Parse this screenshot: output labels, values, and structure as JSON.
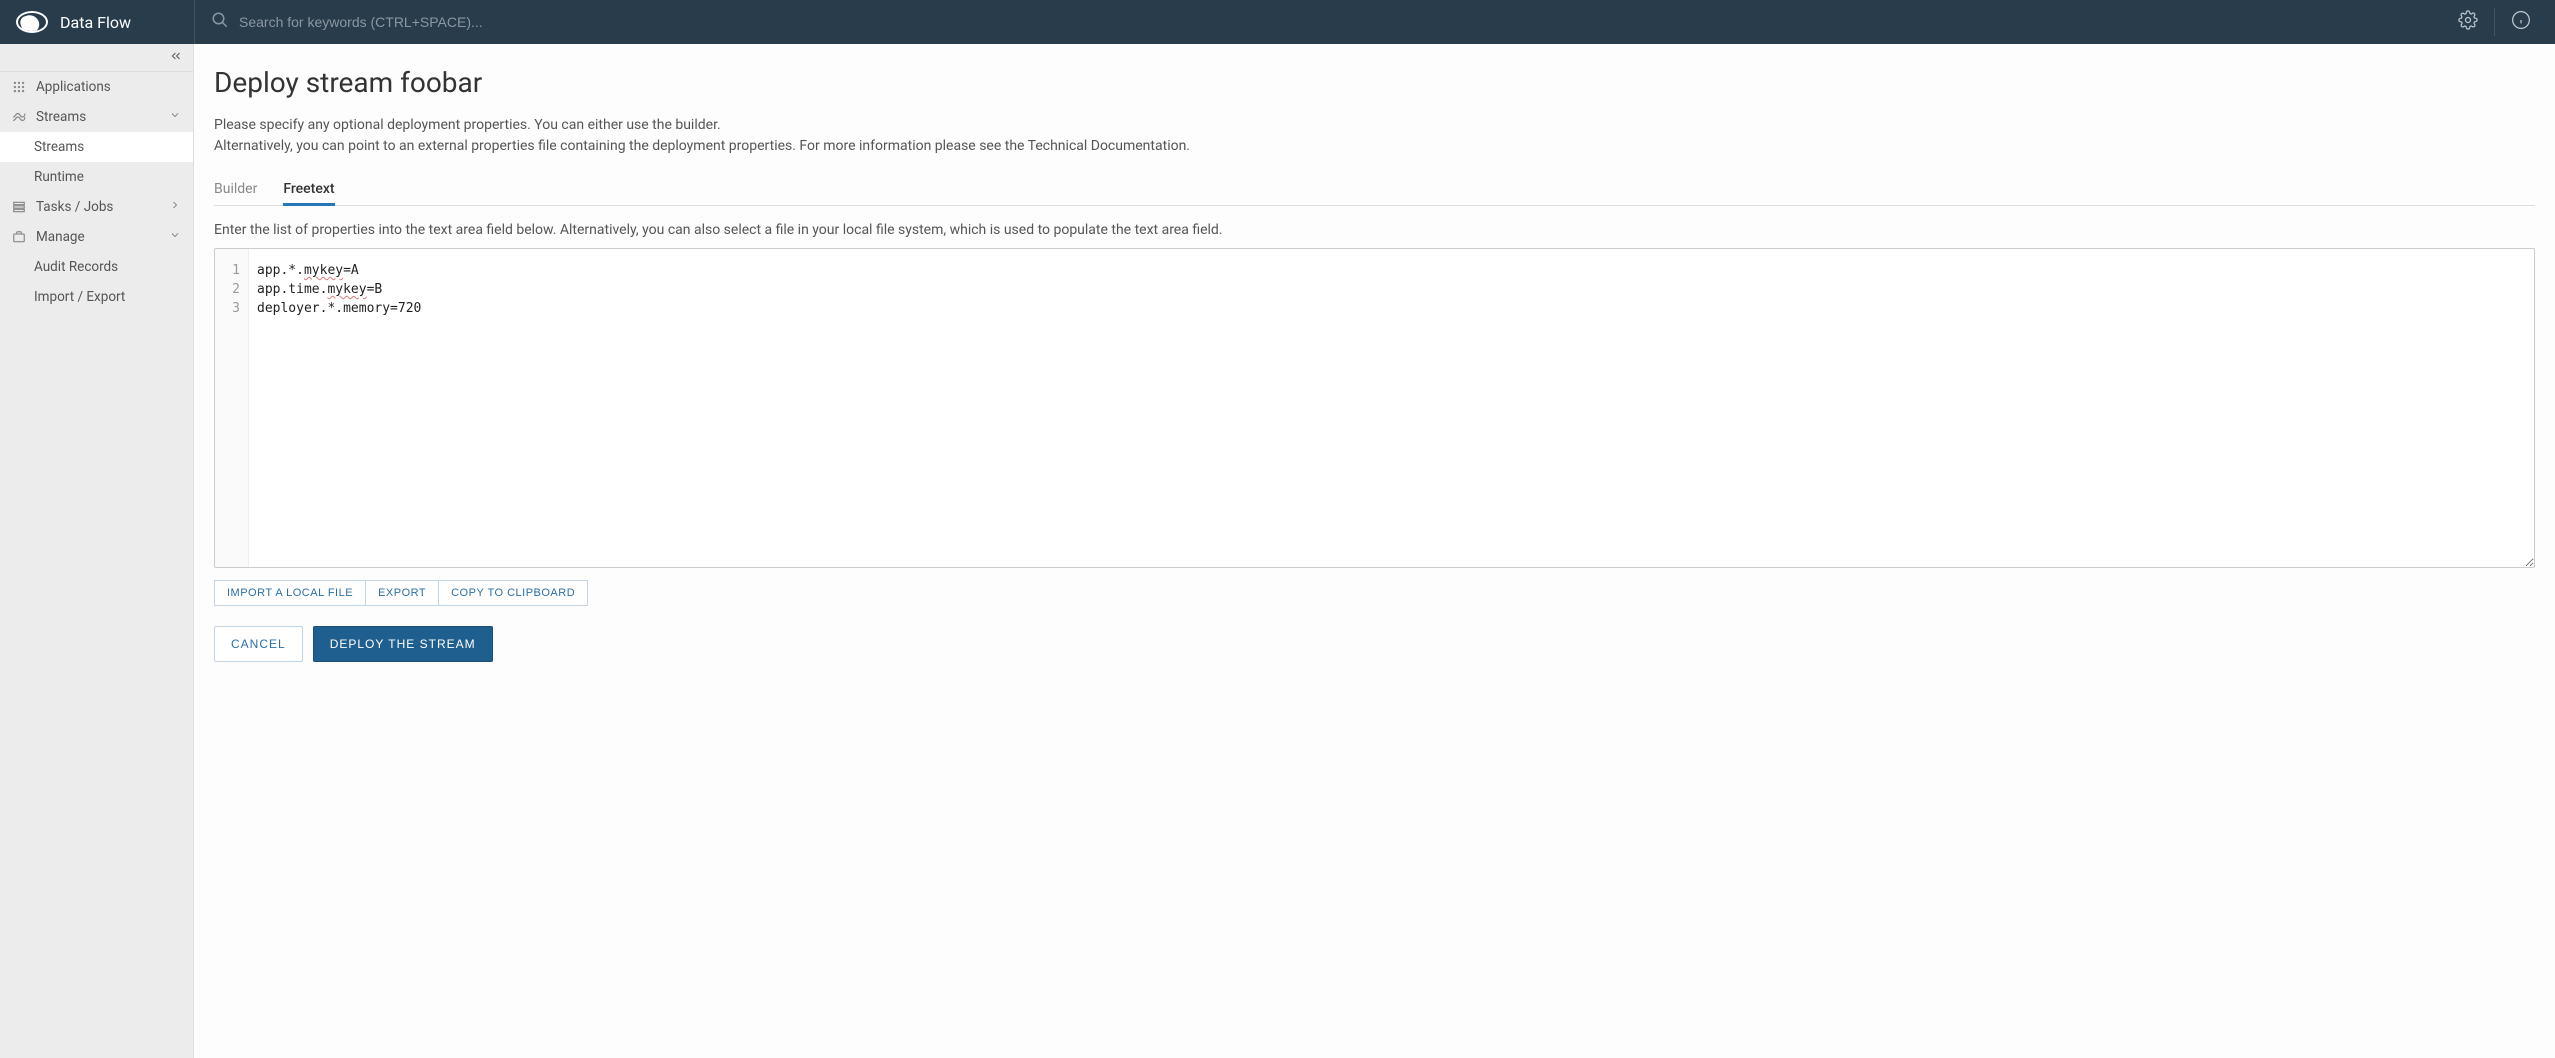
{
  "header": {
    "app_name": "Data Flow",
    "search_placeholder": "Search for keywords (CTRL+SPACE)..."
  },
  "sidebar": {
    "items": [
      {
        "label": "Applications",
        "icon": "grid-icon",
        "expandable": false
      },
      {
        "label": "Streams",
        "icon": "streams-icon",
        "expandable": true,
        "expanded": true,
        "children": [
          {
            "label": "Streams",
            "active": true
          },
          {
            "label": "Runtime",
            "active": false
          }
        ]
      },
      {
        "label": "Tasks / Jobs",
        "icon": "tasks-icon",
        "expandable": true,
        "expanded": false
      },
      {
        "label": "Manage",
        "icon": "manage-icon",
        "expandable": true,
        "expanded": true,
        "children": [
          {
            "label": "Audit Records",
            "active": false
          },
          {
            "label": "Import / Export",
            "active": false
          }
        ]
      }
    ]
  },
  "main": {
    "title": "Deploy stream foobar",
    "desc_line1": "Please specify any optional deployment properties. You can either use the builder.",
    "desc_line2": "Alternatively, you can point to an external properties file containing the deployment properties. For more information please see the Technical Documentation.",
    "tabs": [
      {
        "label": "Builder",
        "active": false
      },
      {
        "label": "Freetext",
        "active": true
      }
    ],
    "hint": "Enter the list of properties into the text area field below. Alternatively, you can also select a file in your local file system, which is used to populate the text area field.",
    "editor_lines": [
      "app.*.mykey=A",
      "app.time.mykey=B",
      "deployer.*.memory=720"
    ],
    "toolbar_small": [
      "IMPORT A LOCAL FILE",
      "EXPORT",
      "COPY TO CLIPBOARD"
    ],
    "actions": {
      "cancel": "CANCEL",
      "deploy": "DEPLOY THE STREAM"
    }
  }
}
